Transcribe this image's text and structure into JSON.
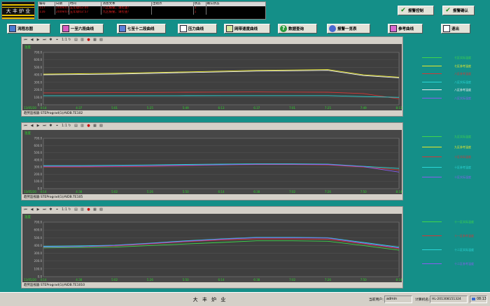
{
  "logo": {
    "text": "大 丰 炉 业"
  },
  "alarm": {
    "headers": [
      "编号",
      "日期",
      "时间",
      "消息文本",
      "出错点",
      "状态",
      "确认状态"
    ],
    "rows": [
      [
        "117",
        "2009/07/...",
        "五年级02:00",
        "八区报警，请检查!",
        "",
        "1",
        ""
      ],
      [
        "116",
        "2009/07/...",
        "五年级02:57",
        "九区报警，请检查!",
        "",
        "1",
        ""
      ]
    ]
  },
  "top_buttons": {
    "alarm_control": "报警控制",
    "alarm_confirm": "报警确认"
  },
  "nav": {
    "overview": "流程总图",
    "zone_1_6": "一至六段曲线",
    "zone_7_12": "七至十二段曲线",
    "pressure": "压力曲线",
    "mesh_speed": "网带速度曲线",
    "data_query": "数据查询",
    "alarm_list": "报警一览表",
    "ref_curve": "参考曲线",
    "exit": "退出"
  },
  "colors": {
    "teal_bg": "#148f88",
    "plot_bg": "#474747",
    "green": "#3fd64a",
    "yellow": "#e8e82a",
    "red": "#d03838",
    "cyan": "#2ad8d8",
    "white": "#f0f0f0",
    "violet": "#8a5cf0"
  },
  "panels": [
    {
      "y_unit": "温度",
      "y_ticks": [
        "700.0",
        "600.0",
        "500.0",
        "400.0",
        "300.0",
        "200.0",
        "100.0",
        "0.0"
      ],
      "x_ticks": [
        "4:14",
        "4:37",
        "5:01",
        "5:25",
        "5:49",
        "6:13",
        "6:37",
        "7:01",
        "7:25",
        "7:49",
        "8:13"
      ],
      "date": "13/05/20",
      "footer": "趋势监视器 STEPrograd(1)/AIDB.TE102"
    },
    {
      "y_unit": "温度",
      "y_ticks": [
        "700.0",
        "600.0",
        "500.0",
        "400.0",
        "300.0",
        "200.0",
        "100.0",
        "0.0"
      ],
      "x_ticks": [
        "4:14",
        "4:38",
        "5:02",
        "5:26",
        "5:50",
        "6:14",
        "6:38",
        "7:02",
        "7:26",
        "7:50",
        "8:14"
      ],
      "date": "13/05/20",
      "footer": "趋势监视器 STEPrograd(1)/AIDB.TE105"
    },
    {
      "y_unit": "温度",
      "y_ticks": [
        "700.0",
        "600.0",
        "500.0",
        "400.0",
        "300.0",
        "200.0",
        "100.0",
        "0.0"
      ],
      "x_ticks": [
        "4:14",
        "4:38",
        "5:02",
        "5:26",
        "5:50",
        "6:14",
        "6:38",
        "7:02",
        "7:26",
        "7:50",
        "8:14"
      ],
      "date": "13/05/20",
      "footer": "趋势监视器 STEPrograd(1)/AIDB.TE1010"
    }
  ],
  "legend1": [
    "七区实际温度",
    "七区参考温度",
    "八区参考温度",
    "八区实际温度",
    "八区参考温度",
    "八区实际温度"
  ],
  "legend2": [
    "九区实际温度",
    "九区参考温度",
    "十区实际温度",
    "十区参考温度",
    "十区实际温度"
  ],
  "legend3": [
    "十一区实际温度",
    "十一区参考温度",
    "十二区实际温度",
    "十二区参考温度"
  ],
  "chart_data": [
    {
      "type": "line",
      "ylim": [
        0,
        700
      ],
      "x": [
        "4:14",
        "4:37",
        "5:01",
        "5:25",
        "5:49",
        "6:13",
        "6:37",
        "7:01",
        "7:25",
        "7:49",
        "8:13"
      ],
      "series": [
        {
          "name": "七区实际温度",
          "values": [
            410,
            415,
            420,
            430,
            440,
            450,
            460,
            465,
            470,
            400,
            370
          ]
        },
        {
          "name": "七区参考温度",
          "values": [
            400,
            405,
            410,
            420,
            430,
            440,
            450,
            455,
            460,
            390,
            360
          ]
        },
        {
          "name": "八区参考温度",
          "values": [
            160,
            160,
            162,
            165,
            168,
            170,
            172,
            170,
            168,
            150,
            80
          ]
        },
        {
          "name": "八区实际温度",
          "values": [
            120,
            120,
            120,
            120,
            121,
            122,
            122,
            122,
            122,
            110,
            100
          ]
        }
      ]
    },
    {
      "type": "line",
      "ylim": [
        0,
        700
      ],
      "x": [
        "4:14",
        "4:38",
        "5:02",
        "5:26",
        "5:50",
        "6:14",
        "6:38",
        "7:02",
        "7:26",
        "7:50",
        "8:14"
      ],
      "series": [
        {
          "name": "九区实际温度",
          "values": [
            300,
            300,
            305,
            310,
            320,
            330,
            335,
            335,
            330,
            300,
            260
          ]
        },
        {
          "name": "十区参考温度",
          "values": [
            320,
            320,
            325,
            330,
            335,
            340,
            345,
            345,
            340,
            310,
            280
          ]
        },
        {
          "name": "十区实际温度",
          "values": [
            310,
            310,
            312,
            318,
            325,
            332,
            338,
            338,
            335,
            305,
            230
          ]
        }
      ]
    },
    {
      "type": "line",
      "ylim": [
        0,
        700
      ],
      "x": [
        "4:14",
        "4:38",
        "5:02",
        "5:26",
        "5:50",
        "6:14",
        "6:38",
        "7:02",
        "7:26",
        "7:50",
        "8:14"
      ],
      "series": [
        {
          "name": "十一区实际温度",
          "values": [
            370,
            375,
            380,
            400,
            420,
            440,
            460,
            460,
            455,
            400,
            340
          ]
        },
        {
          "name": "十一区参考温度",
          "values": [
            380,
            385,
            395,
            420,
            450,
            470,
            485,
            485,
            480,
            420,
            360
          ]
        },
        {
          "name": "十二区参考温度",
          "values": [
            390,
            395,
            405,
            430,
            460,
            485,
            505,
            505,
            500,
            440,
            380
          ]
        },
        {
          "name": "十二区实际温度",
          "values": [
            380,
            385,
            400,
            425,
            455,
            480,
            500,
            500,
            495,
            430,
            370
          ]
        }
      ]
    }
  ],
  "status": {
    "title": "大 丰 炉 业",
    "current_user_label": "当前用户:",
    "current_user": "admin",
    "computer_label": "计算机名:",
    "computer_name": "HL-201308151324",
    "time": "08:13"
  }
}
